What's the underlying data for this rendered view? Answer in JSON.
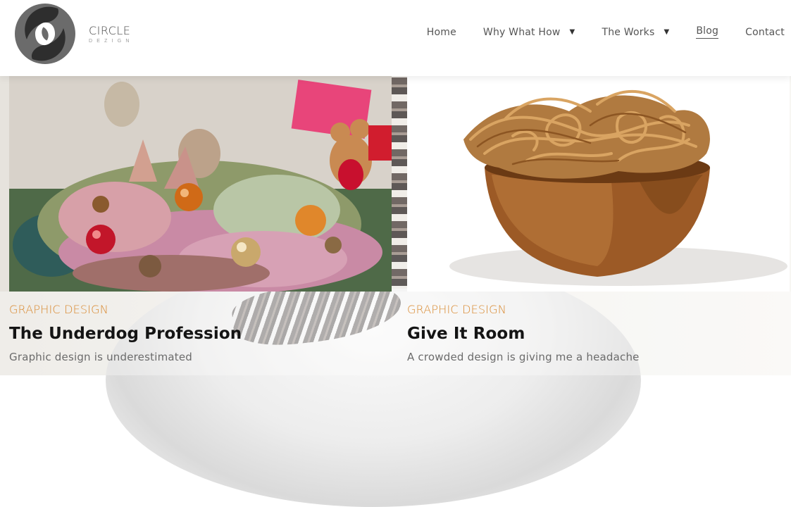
{
  "brand": {
    "name": "CIRCLE",
    "subname": "DEZIGN"
  },
  "nav": {
    "items": [
      {
        "label": "Home",
        "has_dropdown": false,
        "active": false
      },
      {
        "label": "Why What How",
        "has_dropdown": true,
        "active": false
      },
      {
        "label": "The Works",
        "has_dropdown": true,
        "active": false
      },
      {
        "label": "Blog",
        "has_dropdown": false,
        "active": true
      },
      {
        "label": "Contact",
        "has_dropdown": false,
        "active": false
      }
    ],
    "caret_glyph": "▼"
  },
  "posts": [
    {
      "category": "GRAPHIC DESIGN",
      "title": "The Underdog Profession",
      "excerpt": "Graphic design is underestimated",
      "image_icon": "flower-bouquet-image"
    },
    {
      "category": "GRAPHIC DESIGN",
      "title": "Give It Room",
      "excerpt": "A crowded design is giving me a headache",
      "image_icon": "twine-bowl-image"
    }
  ],
  "colors": {
    "accent": "#d9892f",
    "title": "#141414",
    "nav_text": "#555555",
    "logo_gray": "#4a4a4a"
  }
}
